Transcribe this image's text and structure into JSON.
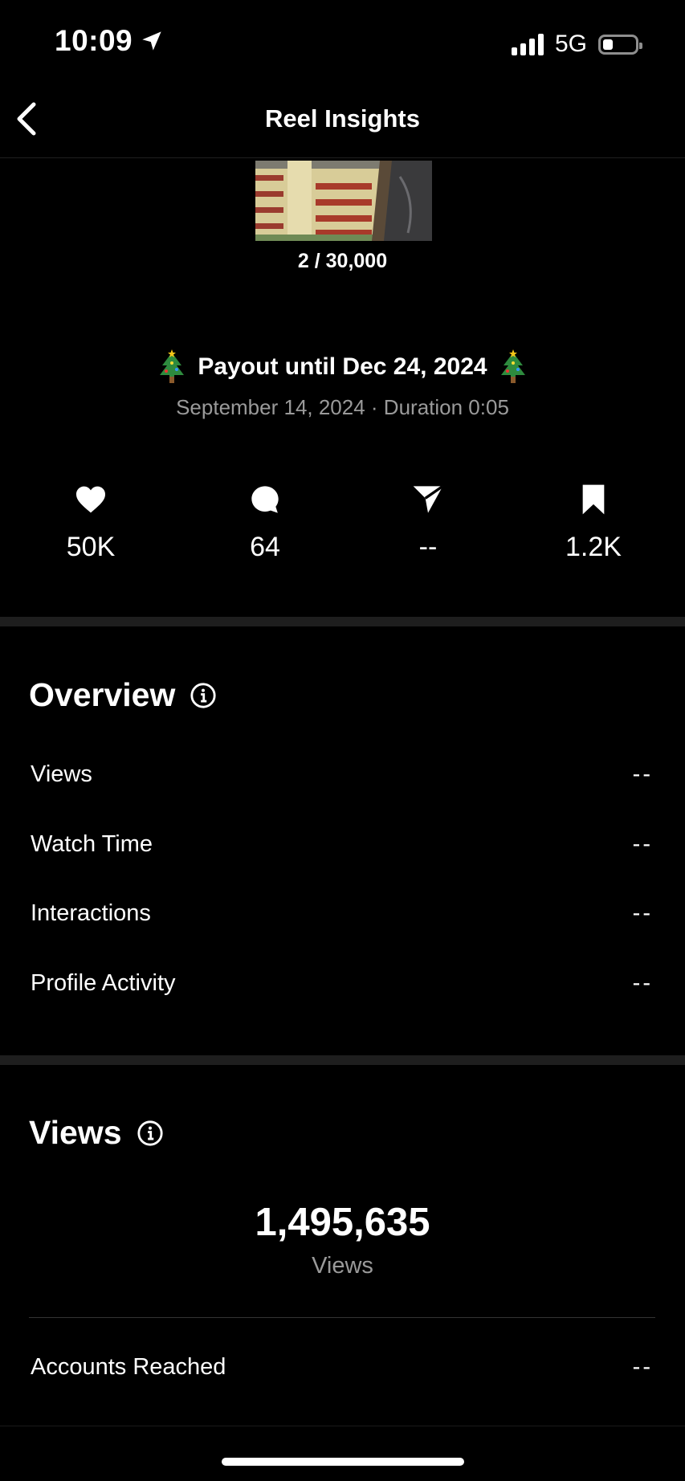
{
  "status_bar": {
    "time": "10:09",
    "network": "5G"
  },
  "header": {
    "title": "Reel Insights"
  },
  "reel": {
    "counter": "2 / 30,000",
    "payout": "Payout until Dec 24, 2024",
    "subline": "September 14, 2024 · Duration 0:05"
  },
  "stats": {
    "likes": "50K",
    "comments": "64",
    "shares": "--",
    "saves": "1.2K"
  },
  "overview": {
    "title": "Overview",
    "rows": [
      {
        "label": "Views",
        "value": "--"
      },
      {
        "label": "Watch Time",
        "value": "--"
      },
      {
        "label": "Interactions",
        "value": "--"
      },
      {
        "label": "Profile Activity",
        "value": "--"
      }
    ]
  },
  "views_section": {
    "title": "Views",
    "total": "1,495,635",
    "total_label": "Views",
    "rows": [
      {
        "label": "Accounts Reached",
        "value": "--"
      }
    ]
  },
  "colors": {
    "background": "#000000",
    "muted_text": "#9a9a9a",
    "separator": "#1e1e1e"
  }
}
